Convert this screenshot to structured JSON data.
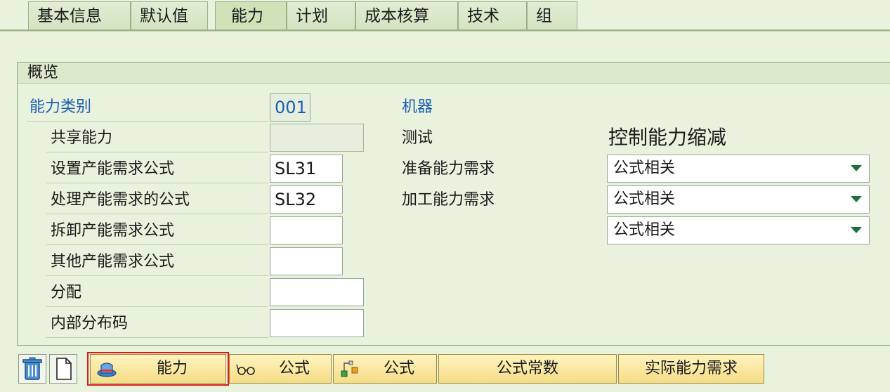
{
  "tabs": [
    {
      "label": "基本信息"
    },
    {
      "label": "默认值"
    },
    {
      "label": "能力"
    },
    {
      "label": "计划"
    },
    {
      "label": "成本核算"
    },
    {
      "label": "技术"
    },
    {
      "label": "组"
    }
  ],
  "active_tab": "能力",
  "overview": {
    "title": "概览",
    "capacity_category_label": "能力类别",
    "capacity_category_value": "001",
    "machine_label": "机器",
    "shared_capacity_label": "共享能力",
    "shared_capacity_value": "",
    "setup_formula_label": "设置产能需求公式",
    "setup_formula_value": "SL31",
    "processing_formula_label": "处理产能需求的公式",
    "processing_formula_value": "SL32",
    "teardown_formula_label": "拆卸产能需求公式",
    "teardown_formula_value": "",
    "other_formula_label": "其他产能需求公式",
    "other_formula_value": "",
    "allocation_label": "分配",
    "allocation_value": "",
    "distribution_key_label": "内部分布码",
    "distribution_key_value": "",
    "test_label": "测试",
    "control_reduction_title": "控制能力缩减",
    "setup_req_label": "准备能力需求",
    "setup_req_value": "公式相关",
    "processing_req_label": "加工能力需求",
    "processing_req_value": "公式相关",
    "teardown_req_value": "公式相关"
  },
  "toolbar": {
    "capacity_button": "能力",
    "formula_button_1": "公式",
    "formula_button_2": "公式",
    "formula_constants_button": "公式常数",
    "actual_capacity_req_button": "实际能力需求"
  }
}
